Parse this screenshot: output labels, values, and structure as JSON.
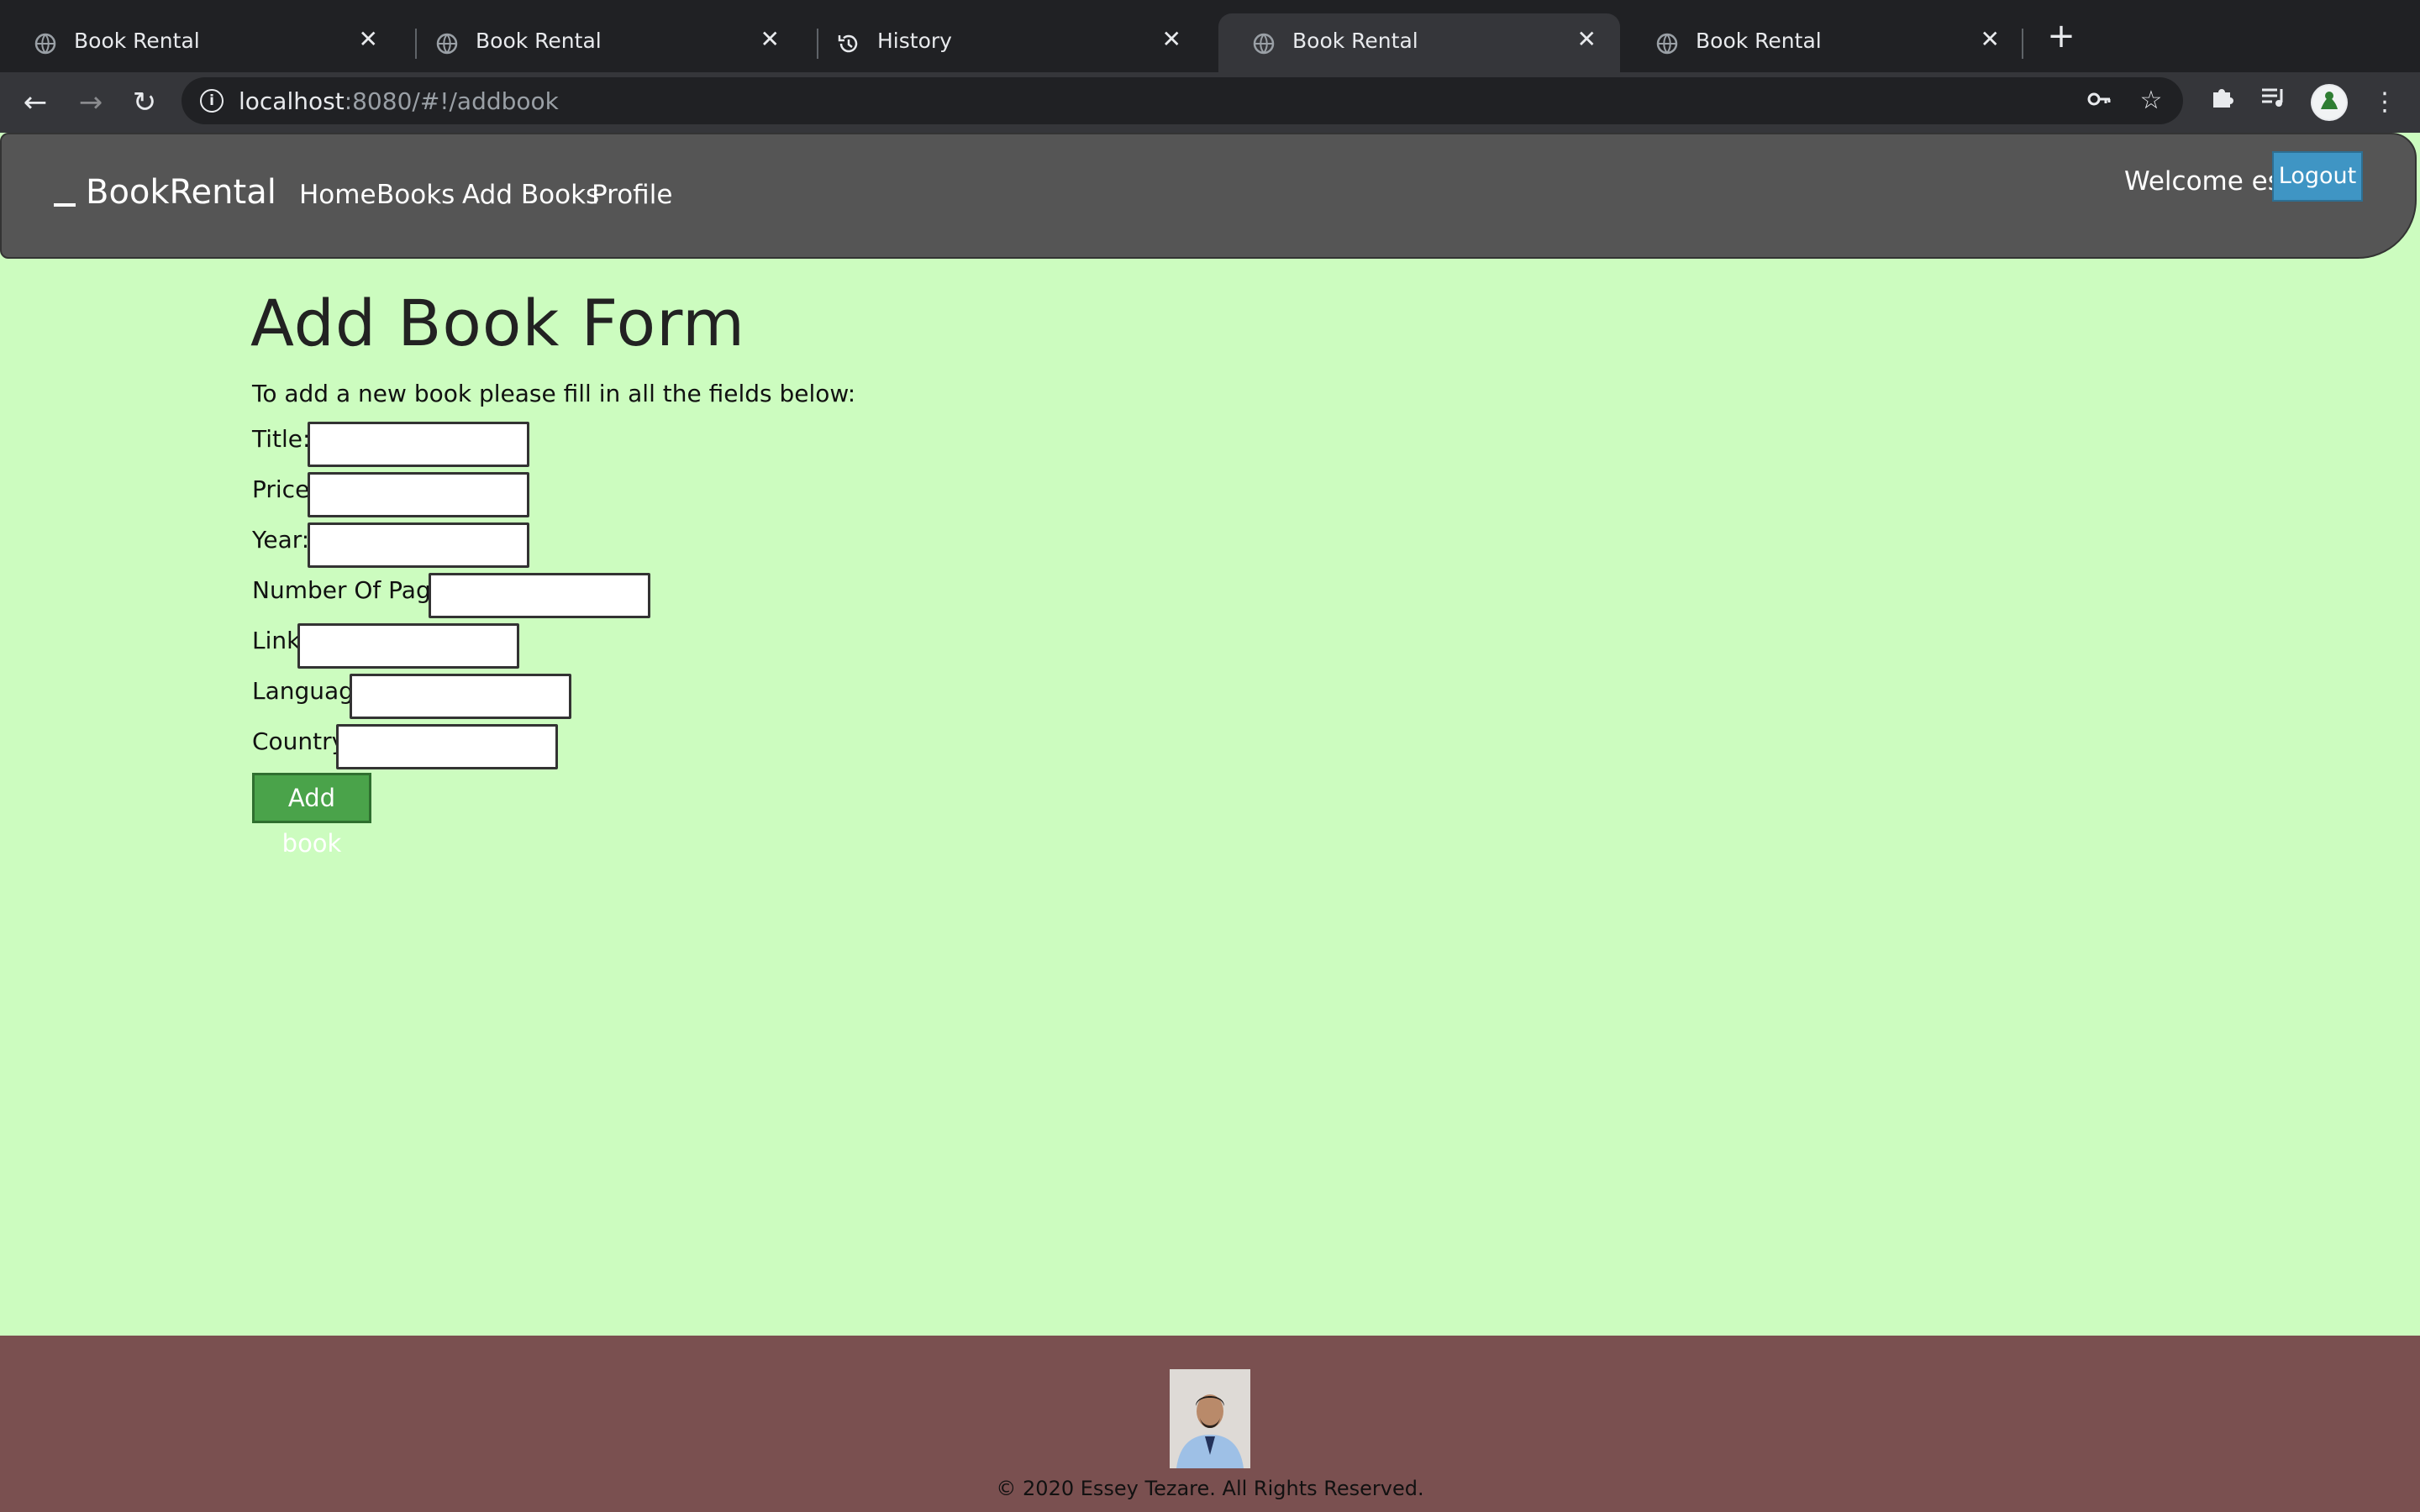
{
  "browser": {
    "tabs": [
      {
        "title": "Book Rental",
        "icon": "globe-icon",
        "active": false
      },
      {
        "title": "Book Rental",
        "icon": "globe-icon",
        "active": false
      },
      {
        "title": "History",
        "icon": "history-icon",
        "active": false
      },
      {
        "title": "Book Rental",
        "icon": "globe-icon",
        "active": true
      },
      {
        "title": "Book Rental",
        "icon": "globe-icon",
        "active": false
      }
    ],
    "url_host": "localhost",
    "url_rest": ":8080/#!/addbook"
  },
  "navbar": {
    "brand": "BookRental",
    "links": [
      "Home",
      "Books",
      "Add Books",
      "Profile"
    ],
    "welcome": "Welcome essey",
    "logout_label": "Logout",
    "background": "#555555"
  },
  "form": {
    "title": "Add Book Form",
    "intro": "To add a new book please fill in all the fields below:",
    "fields": {
      "title": {
        "label": "Title:",
        "value": ""
      },
      "price": {
        "label": "Price:",
        "value": ""
      },
      "year": {
        "label": "Year:",
        "value": ""
      },
      "pages": {
        "label": "Number Of Pages:",
        "value": ""
      },
      "link": {
        "label": "Link:",
        "value": ""
      },
      "language": {
        "label": "Language:",
        "value": ""
      },
      "country": {
        "label": "Country:",
        "value": ""
      }
    },
    "submit_label": "Add book"
  },
  "footer": {
    "copyright": "© 2020 Essey Tezare. All Rights Reserved.",
    "background": "#7a5050"
  },
  "colors": {
    "page_background": "#ccfcbf",
    "logout_button": "#3f95c4",
    "add_button": "#4aa34a"
  }
}
